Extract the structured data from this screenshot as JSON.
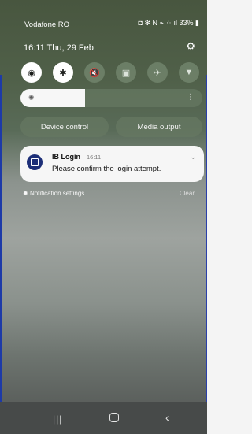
{
  "status_bar": {
    "carrier": "Vodafone RO",
    "icons": "◘ ✻ N ⌁ ⁘ ıl",
    "battery": "33%"
  },
  "quick_panel": {
    "time": "16:11",
    "date": "Thu, 29 Feb",
    "settings_icon": "gear-icon",
    "toggles": [
      {
        "name": "wifi",
        "icon": "wifi-icon",
        "state": "on"
      },
      {
        "name": "bluetooth",
        "icon": "bluetooth-icon",
        "state": "on"
      },
      {
        "name": "sound",
        "icon": "mute-icon",
        "state": "off"
      },
      {
        "name": "rotation",
        "icon": "rotation-lock-icon",
        "state": "off"
      },
      {
        "name": "airplane",
        "icon": "airplane-icon",
        "state": "off"
      },
      {
        "name": "flashlight",
        "icon": "flashlight-icon",
        "state": "off"
      }
    ],
    "brightness_level": 0.35,
    "device_control": "Device control",
    "media_output": "Media output"
  },
  "notification": {
    "app": "IB Login",
    "time": "16:11",
    "message": "Please confirm the login attempt."
  },
  "notification_footer": {
    "settings": "Notification settings",
    "clear": "Clear"
  },
  "colors": {
    "accent": "#1d3aa8",
    "panel": "#667862",
    "notification_bg": "#f6f6f6"
  }
}
